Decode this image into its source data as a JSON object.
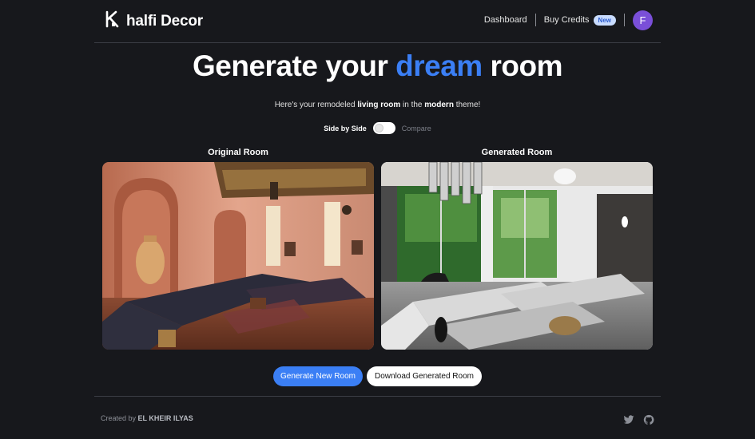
{
  "header": {
    "brand": "halfi Decor",
    "nav": {
      "dashboard": "Dashboard",
      "buy_credits": "Buy Credits",
      "badge": "New"
    },
    "avatar_initial": "F"
  },
  "hero": {
    "title_start": "Generate your",
    "title_accent": "dream",
    "title_end": "room",
    "subtitle_pre": "Here's your remodeled",
    "room_type": "living room",
    "subtitle_mid": "in the",
    "theme": "modern",
    "subtitle_post": "theme!"
  },
  "toggle": {
    "left_label": "Side by Side",
    "right_label": "Compare"
  },
  "comparison": {
    "original_title": "Original Room",
    "generated_title": "Generated Room"
  },
  "actions": {
    "generate_new": "Generate New Room",
    "download": "Download Generated Room"
  },
  "footer": {
    "created_by": "Created by",
    "author": "EL KHEIR ILYAS"
  },
  "icons": {
    "logo": "logo-icon",
    "twitter": "twitter-icon",
    "github": "github-icon"
  },
  "colors": {
    "background": "#17181c",
    "accent": "#3b7ff5",
    "avatar": "#7a4fd8"
  }
}
